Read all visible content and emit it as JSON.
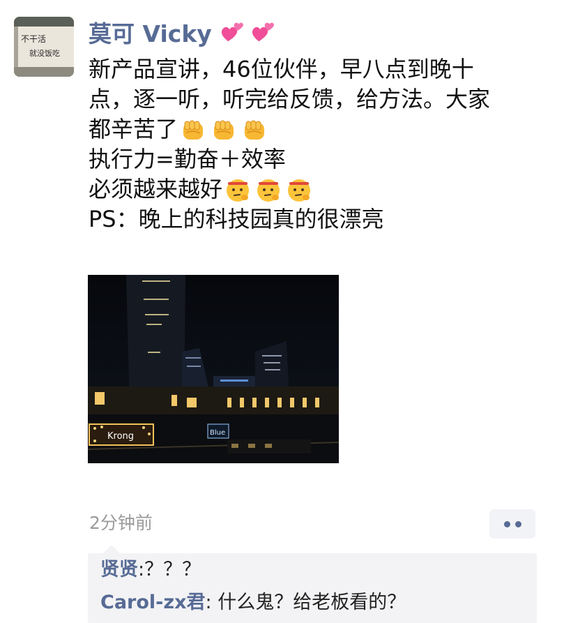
{
  "moment": {
    "username": "莫可 Vicky",
    "username_decor_icon": "two-hearts-icon",
    "avatar_text": [
      "不干活",
      "就没饭吃"
    ],
    "lines": [
      {
        "text": "新产品宣讲，46位伙伴，早八点到晚十"
      },
      {
        "text": "点，逐一听，听完给反馈，给方法。大家"
      },
      {
        "text": "都辛苦了",
        "emoji": "fist-icon",
        "emoji_count": 3
      },
      {
        "text": "执行力=勤奋＋效率"
      },
      {
        "text": "必须越来越好",
        "emoji": "thinking-face-icon",
        "emoji_count": 3
      },
      {
        "text": "PS：晚上的科技园真的很漂亮"
      }
    ],
    "photo_signs": [
      "Krong",
      "Blue"
    ]
  },
  "footer": {
    "timestamp": "2分钟前",
    "more_icon": "more-dots-icon",
    "accent_color": "#576b95"
  },
  "comments": [
    {
      "author": "贤贤",
      "separator": ":",
      "text": "？？？"
    },
    {
      "author": "Carol-zx君",
      "separator": ":",
      "text": " 什么鬼？给老板看的？"
    }
  ]
}
